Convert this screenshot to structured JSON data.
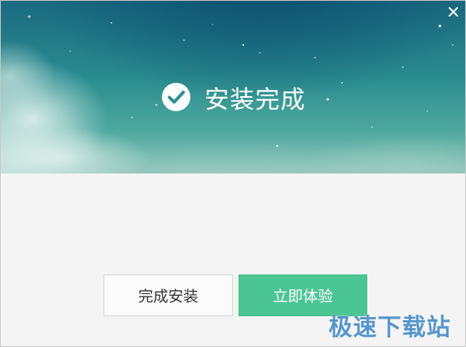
{
  "window": {
    "close_icon": "close-icon"
  },
  "banner": {
    "status_icon": "checkmark-circle-icon",
    "title": "安装完成"
  },
  "actions": {
    "finish_label": "完成安装",
    "experience_label": "立即体验"
  },
  "watermark": {
    "text": "极速下载站"
  },
  "colors": {
    "banner_top": "#1b6a80",
    "banner_bottom": "#8dc3b8",
    "primary_button": "#4cc594",
    "secondary_button": "#fbfbfb",
    "body_background": "#f4f4f4"
  }
}
